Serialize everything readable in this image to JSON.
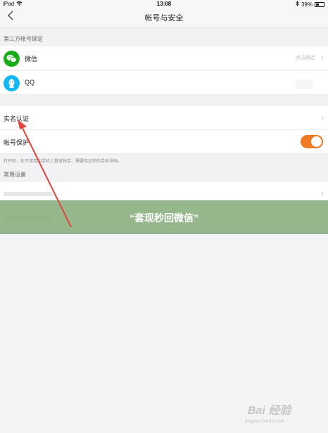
{
  "status_bar": {
    "device": "iPad",
    "time": "13:08",
    "battery": "39%"
  },
  "nav": {
    "title": "帐号与安全"
  },
  "third_party": {
    "header": "第三方帐号绑定",
    "items": [
      {
        "label": "微信",
        "hint": "点击绑定",
        "icon": "wechat-icon",
        "color": "#1aad19"
      },
      {
        "label": "QQ",
        "icon": "qq-icon",
        "color": "#12b7f5"
      }
    ]
  },
  "real_name": {
    "label": "实名认证"
  },
  "protection": {
    "label": "帐号保护",
    "enabled": true,
    "toggle_color": "#f07a21",
    "note": "打开时，在不常用的手机上登录快手，需要验证你的手机号码。"
  },
  "devices": {
    "header": "常用设备"
  },
  "banner": {
    "text": "“套现秒回微信”",
    "color": "#84aa78"
  },
  "watermark": {
    "text": "Bai 经验",
    "sub": "jingyan.baidu.com"
  },
  "annotation": {
    "arrow_color": "#e0463f"
  }
}
